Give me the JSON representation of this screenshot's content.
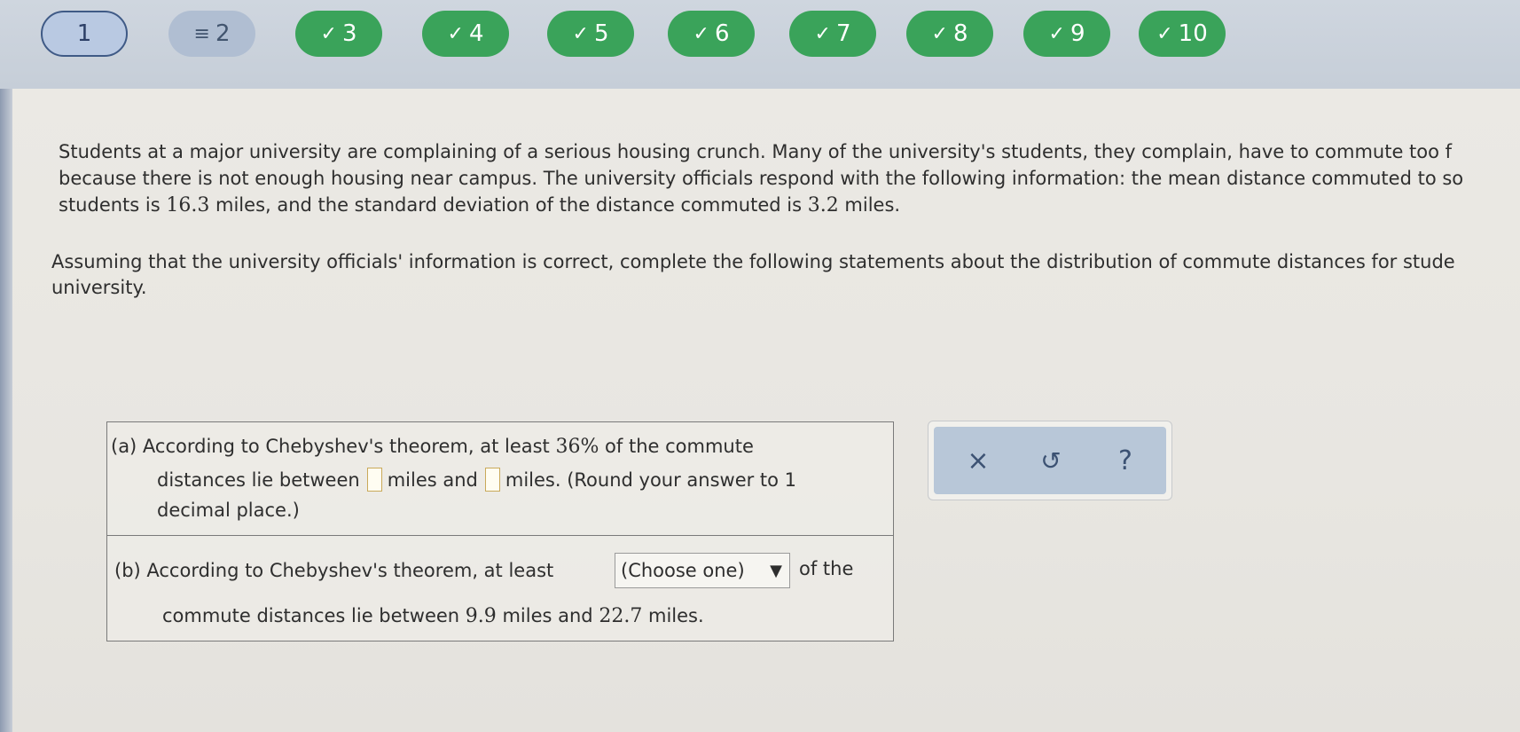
{
  "nav": {
    "items": [
      {
        "label": "1",
        "state": "current"
      },
      {
        "label": "2",
        "state": "partial",
        "mark": "≡"
      },
      {
        "label": "3",
        "state": "done",
        "mark": "✓"
      },
      {
        "label": "4",
        "state": "done",
        "mark": "✓"
      },
      {
        "label": "5",
        "state": "done",
        "mark": "✓"
      },
      {
        "label": "6",
        "state": "done",
        "mark": "✓"
      },
      {
        "label": "7",
        "state": "done",
        "mark": "✓"
      },
      {
        "label": "8",
        "state": "done",
        "mark": "✓"
      },
      {
        "label": "9",
        "state": "done",
        "mark": "✓"
      },
      {
        "label": "10",
        "state": "done",
        "mark": "✓"
      }
    ]
  },
  "problem": {
    "p1_line1": "Students at a major university are complaining of a serious housing crunch. Many of the university's students, they complain, have to commute too f",
    "p1_line2": "because there is not enough housing near campus. The university officials respond with the following information: the mean distance commuted to so",
    "p1_line3_a": "students is ",
    "mean": "16.3",
    "p1_line3_b": " miles, and the standard deviation of the distance commuted is ",
    "sd": "3.2",
    "p1_line3_c": " miles.",
    "p2_line1": "Assuming that the university officials' information is correct, complete the following statements about the distribution of commute distances for stude",
    "p2_line2": "university."
  },
  "part_a": {
    "line1_a": "(a) According to Chebyshev's theorem, at least ",
    "percent": "36%",
    "line1_b": " of the commute",
    "line2_a": "distances lie between",
    "line2_b": "miles and",
    "line2_c": "miles. (Round your answer to 1",
    "line3": "decimal place.)"
  },
  "part_b": {
    "line1_a": "(b) According to Chebyshev's theorem, at least",
    "dropdown_label": "(Choose one)",
    "dropdown_arrow": "▼",
    "line1_b": "of the",
    "line2_a": "commute distances lie between ",
    "low": "9.9",
    "line2_b": " miles and ",
    "high": "22.7",
    "line2_c": " miles."
  },
  "tools": {
    "clear": "×",
    "undo": "↺",
    "help": "?"
  },
  "colors": {
    "done": "#3aa35a",
    "current_border": "#3f5a86",
    "tool_panel": "#b8c7d8"
  }
}
